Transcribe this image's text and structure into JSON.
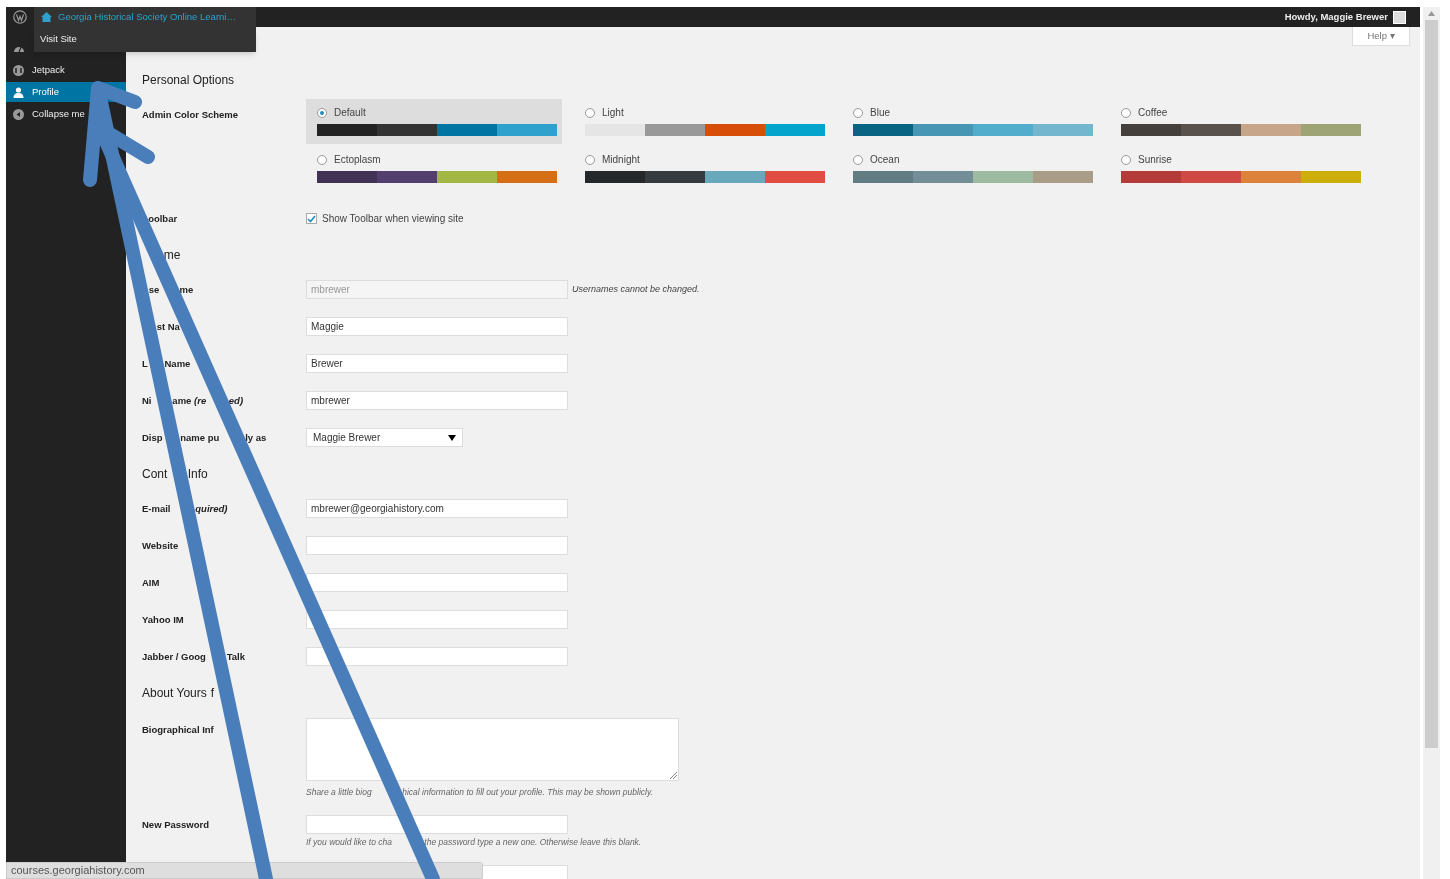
{
  "admin_bar": {
    "site_name": "Georgia Historical Society Online Learni…",
    "menu_item": "Visit Site",
    "greeting": "Howdy, Maggie Brewer"
  },
  "sidebar": {
    "items": [
      {
        "kind": "icon",
        "selected": false
      },
      {
        "kind": "jetpack",
        "label": "Jetpack",
        "selected": false
      },
      {
        "kind": "profile",
        "label": "Profile",
        "selected": true
      },
      {
        "kind": "collapse",
        "label": "Collapse me",
        "selected": false
      }
    ]
  },
  "help_button": "Help ▾",
  "sections": [
    {
      "heading": [
        "Personal Options"
      ],
      "rows": [
        {
          "kind": "schemes",
          "label": [
            "Admin Color Scheme"
          ],
          "schemes": [
            {
              "name": "Default",
              "selected": true,
              "swatches": [
                {
                  "color": "#222222"
                },
                {
                  "color": "#333333"
                },
                {
                  "color": "#0074a2"
                },
                {
                  "color": "#2ea2cc"
                }
              ]
            },
            {
              "name": "Light",
              "selected": false,
              "swatches": [
                {
                  "color": "#e5e5e5"
                },
                {
                  "color": "#999999"
                },
                {
                  "color": "#d64e07"
                },
                {
                  "color": "#04a4cc"
                }
              ]
            },
            {
              "name": "Blue",
              "selected": false,
              "swatches": [
                {
                  "color": "#096484"
                },
                {
                  "color": "#4796b3"
                },
                {
                  "color": "#52accc"
                },
                {
                  "color": "#74b6ce"
                }
              ]
            },
            {
              "name": "Coffee",
              "selected": false,
              "swatches": [
                {
                  "color": "#46403c"
                },
                {
                  "color": "#59524c"
                },
                {
                  "color": "#c7a589"
                },
                {
                  "color": "#9ea476"
                }
              ]
            },
            {
              "name": "Ectoplasm",
              "selected": false,
              "swatches": [
                {
                  "color": "#413256"
                },
                {
                  "color": "#523f6d"
                },
                {
                  "color": "#a3b745"
                },
                {
                  "color": "#d46f15"
                }
              ]
            },
            {
              "name": "Midnight",
              "selected": false,
              "swatches": [
                {
                  "color": "#25282b"
                },
                {
                  "color": "#363b3f"
                },
                {
                  "color": "#69a8bb"
                },
                {
                  "color": "#e14d43"
                }
              ]
            },
            {
              "name": "Ocean",
              "selected": false,
              "swatches": [
                {
                  "color": "#627c83"
                },
                {
                  "color": "#738e96"
                },
                {
                  "color": "#9ebaa0"
                },
                {
                  "color": "#aa9d88"
                }
              ]
            },
            {
              "name": "Sunrise",
              "selected": false,
              "swatches": [
                {
                  "color": "#b43c38"
                },
                {
                  "color": "#cf4944"
                },
                {
                  "color": "#dd823b"
                },
                {
                  "color": "#ccaf0b"
                }
              ]
            }
          ]
        },
        {
          "kind": "checkbox",
          "label": [
            "oolbar"
          ],
          "text": "Show Toolbar when viewing site",
          "checked": true
        }
      ]
    },
    {
      "heading": [
        "me"
      ],
      "rows": [
        {
          "kind": "text",
          "label": [
            "se",
            "me"
          ],
          "value": "mbrewer",
          "disabled": true,
          "note": "Usernames cannot be changed."
        },
        {
          "kind": "text",
          "label": [
            "st Na"
          ],
          "value": "Maggie",
          "disabled": false
        },
        {
          "kind": "text",
          "label": [
            "L",
            "Name"
          ],
          "value": "Brewer",
          "disabled": false
        },
        {
          "kind": "text",
          "label": [
            "Ni",
            "ame *(re*",
            "*ed)*"
          ],
          "value": "mbrewer",
          "disabled": false
        },
        {
          "kind": "select",
          "label": [
            "Disp",
            "name pu",
            "ly as"
          ],
          "value": "Maggie Brewer"
        }
      ]
    },
    {
      "heading": [
        "Cont",
        "Info"
      ],
      "rows": [
        {
          "kind": "text",
          "label": [
            "E-mail",
            "*quired)*"
          ],
          "value": "mbrewer@georgiahistory.com"
        },
        {
          "kind": "text",
          "label": [
            "Website"
          ]
        },
        {
          "kind": "text",
          "label": [
            "AIM"
          ]
        },
        {
          "kind": "text",
          "label": [
            "Yahoo IM"
          ]
        },
        {
          "kind": "text",
          "label": [
            "Jabber / Goog",
            "Talk"
          ]
        }
      ]
    },
    {
      "heading": [
        "About Yours",
        "f"
      ],
      "rows": [
        {
          "kind": "textarea",
          "label": [
            "Biographical Inf"
          ],
          "hint": [
            "Share a little biog",
            "hical information to fill out your profile. This may be shown publicly."
          ]
        },
        {
          "kind": "text",
          "label": [
            "New Password"
          ],
          "hint": [
            "If you would like to cha",
            "the password type a new one. Otherwise leave this blank."
          ]
        },
        {
          "kind": "text"
        }
      ]
    }
  ],
  "status_bar": "courses.georgiahistory.com"
}
